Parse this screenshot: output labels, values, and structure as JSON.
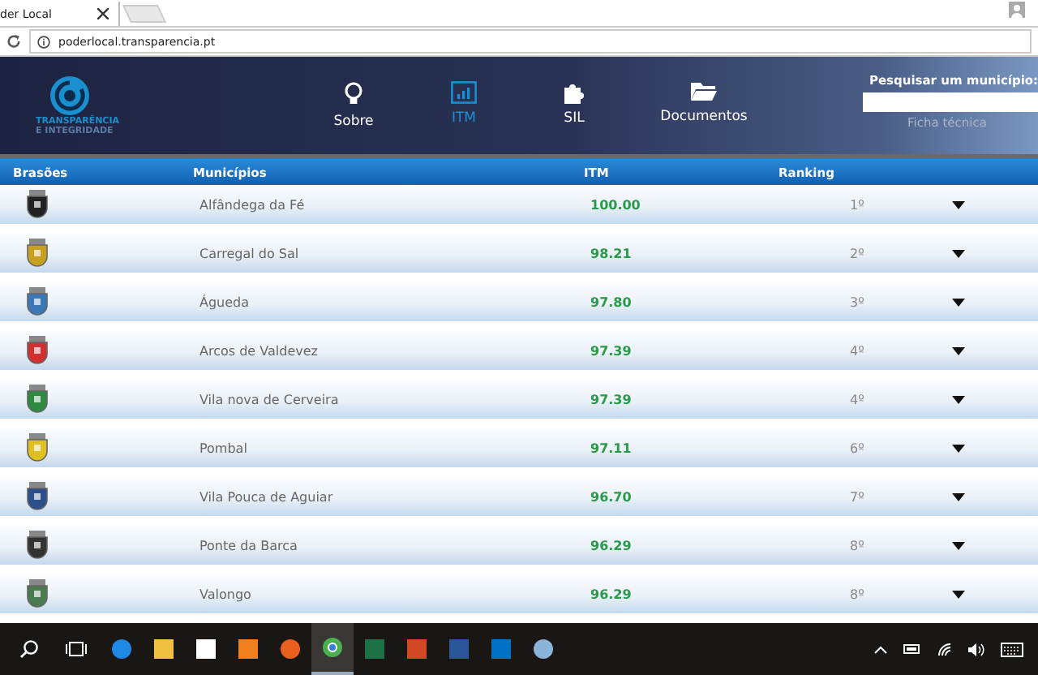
{
  "browser": {
    "tab_title": "der Local",
    "url": "poderlocal.transparencia.pt"
  },
  "header": {
    "logo_lines": [
      "TRANSPARÊNCIA",
      "E INTEGRIDADE"
    ],
    "nav": [
      {
        "label": "Sobre",
        "kind": "bulb",
        "selected": false
      },
      {
        "label": "ITM",
        "kind": "chart",
        "selected": true
      },
      {
        "label": "SIL",
        "kind": "puzzle",
        "selected": false
      },
      {
        "label": "Documentos",
        "kind": "folder",
        "selected": false
      }
    ],
    "search": {
      "label": "Pesquisar um município:",
      "link": "Ficha técnica"
    }
  },
  "table": {
    "columns": [
      "Brasões",
      "Municípios",
      "ITM",
      "Ranking"
    ],
    "rows": [
      {
        "color": "#222222",
        "municipio": "Alfândega da Fé",
        "itm": "100.00",
        "ranking": "1º"
      },
      {
        "color": "#c8a020",
        "municipio": "Carregal do Sal",
        "itm": "98.21",
        "ranking": "2º"
      },
      {
        "color": "#3a78b8",
        "municipio": "Águeda",
        "itm": "97.80",
        "ranking": "3º"
      },
      {
        "color": "#d03030",
        "municipio": "Arcos de Valdevez",
        "itm": "97.39",
        "ranking": "4º"
      },
      {
        "color": "#2e8a40",
        "municipio": "Vila nova de Cerveira",
        "itm": "97.39",
        "ranking": "4º"
      },
      {
        "color": "#e0c020",
        "municipio": "Pombal",
        "itm": "97.11",
        "ranking": "6º"
      },
      {
        "color": "#2a4f8a",
        "municipio": "Vila Pouca de Aguiar",
        "itm": "96.70",
        "ranking": "7º"
      },
      {
        "color": "#333333",
        "municipio": "Ponte da Barca",
        "itm": "96.29",
        "ranking": "8º"
      },
      {
        "color": "#4a7a50",
        "municipio": "Valongo",
        "itm": "96.29",
        "ranking": "8º"
      }
    ]
  },
  "taskbar": {
    "apps": [
      {
        "kind": "edge",
        "selected": false
      },
      {
        "kind": "explorer",
        "selected": false
      },
      {
        "kind": "store",
        "selected": false
      },
      {
        "kind": "media",
        "selected": false
      },
      {
        "kind": "firefox",
        "selected": false
      },
      {
        "kind": "chrome",
        "selected": true
      },
      {
        "kind": "excel",
        "selected": false
      },
      {
        "kind": "powerpoint",
        "selected": false
      },
      {
        "kind": "word",
        "selected": false
      },
      {
        "kind": "outlook",
        "selected": false
      },
      {
        "kind": "paint",
        "selected": false
      }
    ]
  }
}
